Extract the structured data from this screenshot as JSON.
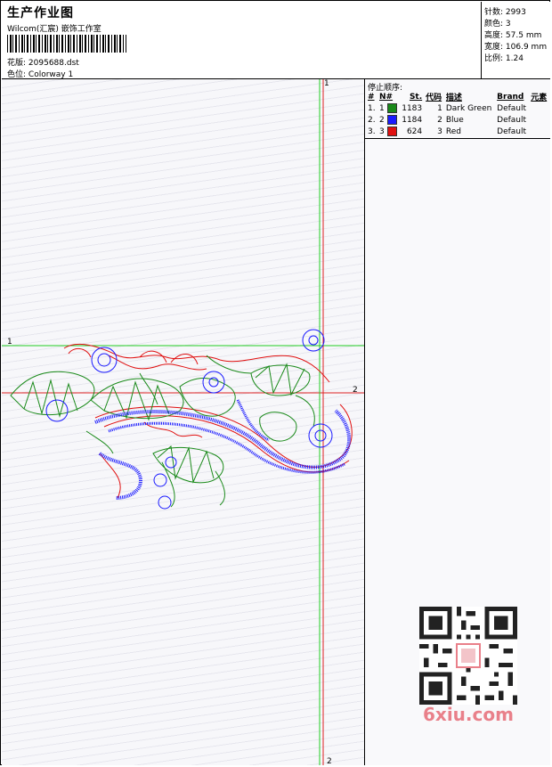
{
  "header": {
    "title": "生产作业图",
    "subtitle": "Wilcom(汇宸) 嵌饰工作室",
    "design_label": "花版:",
    "design_value": "2095688.dst",
    "colorway_label": "色位:",
    "colorway_value": "Colorway 1"
  },
  "stats": [
    {
      "label": "针数:",
      "value": "2993"
    },
    {
      "label": "颜色:",
      "value": "3"
    },
    {
      "label": "高度:",
      "value": "57.5 mm"
    },
    {
      "label": "宽度:",
      "value": "106.9 mm"
    },
    {
      "label": "比例:",
      "value": "1.24"
    }
  ],
  "stop_sequence": {
    "title": "停止顺序:",
    "columns": [
      "#",
      "N#",
      "St.",
      "代码",
      "描述",
      "Brand",
      "元素"
    ],
    "rows": [
      {
        "index": "1.",
        "n": "1",
        "color": "#1a8a1a",
        "stitches": "1183",
        "code": "1",
        "description": "Dark Green",
        "brand": "Default"
      },
      {
        "index": "2.",
        "n": "2",
        "color": "#1a1aff",
        "stitches": "1184",
        "code": "2",
        "description": "Blue",
        "brand": "Default"
      },
      {
        "index": "3.",
        "n": "3",
        "color": "#e01010",
        "stitches": "624",
        "code": "3",
        "description": "Red",
        "brand": "Default"
      }
    ]
  },
  "guides": {
    "h1_top": "1",
    "h2_right": "2",
    "v1_top": "1",
    "v2_bottom": "2"
  },
  "watermark": "6xiu.com",
  "colors": {
    "guide_green": "#22cc22",
    "guide_red": "#dd2222",
    "thread_green": "#1a8a1a",
    "thread_blue": "#1a1aff",
    "thread_red": "#e01010"
  }
}
